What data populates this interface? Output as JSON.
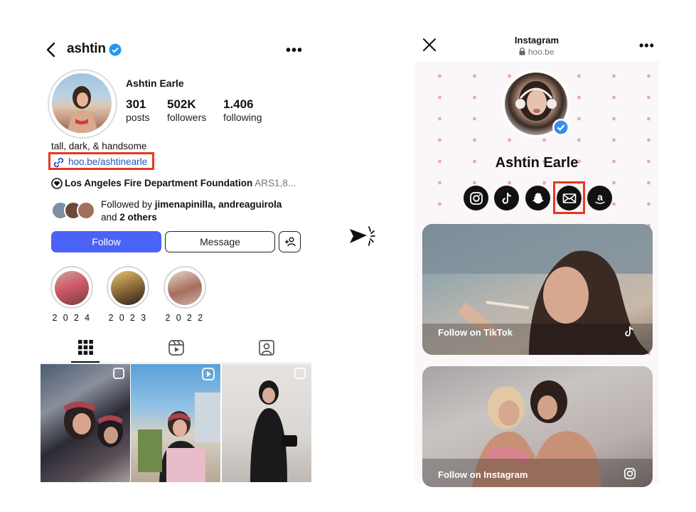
{
  "left": {
    "header": {
      "username": "ashtin",
      "more": "•••"
    },
    "profile": {
      "full_name": "Ashtin Earle",
      "stats": [
        {
          "value": "301",
          "label": "posts"
        },
        {
          "value": "502K",
          "label": "followers"
        },
        {
          "value": "1.406",
          "label": "following"
        }
      ],
      "bio": "tall, dark, & handsome",
      "link": "hoo.be/ashtinearle",
      "fundraiser_name": "Los Angeles Fire Department Foundation",
      "fundraiser_amount": "ARS1,8...",
      "followed_prefix": "Followed by ",
      "followed_names": "jimenapinilla, andreaguirola",
      "followed_and": "and ",
      "followed_others": "2 others"
    },
    "buttons": {
      "follow": "Follow",
      "message": "Message"
    },
    "highlights": [
      {
        "label": "2 0 2 4"
      },
      {
        "label": "2 0 2 3"
      },
      {
        "label": "2 0 2 2"
      }
    ]
  },
  "right": {
    "header": {
      "title": "Instagram",
      "url": "hoo.be",
      "more": "•••"
    },
    "name": "Ashtin Earle",
    "social_icons": [
      "instagram-icon",
      "tiktok-icon",
      "snapchat-icon",
      "mail-icon",
      "amazon-icon"
    ],
    "cards": [
      {
        "label": "Follow on TikTok",
        "icon": "tiktok-icon"
      },
      {
        "label": "Follow on Instagram",
        "icon": "instagram-icon"
      }
    ]
  },
  "colors": {
    "follow_button": "#4b62f7",
    "highlight_box": "#e8371e",
    "link": "#2453b4",
    "verified": "#1d9bf0",
    "hearts": "#e9aab6"
  }
}
